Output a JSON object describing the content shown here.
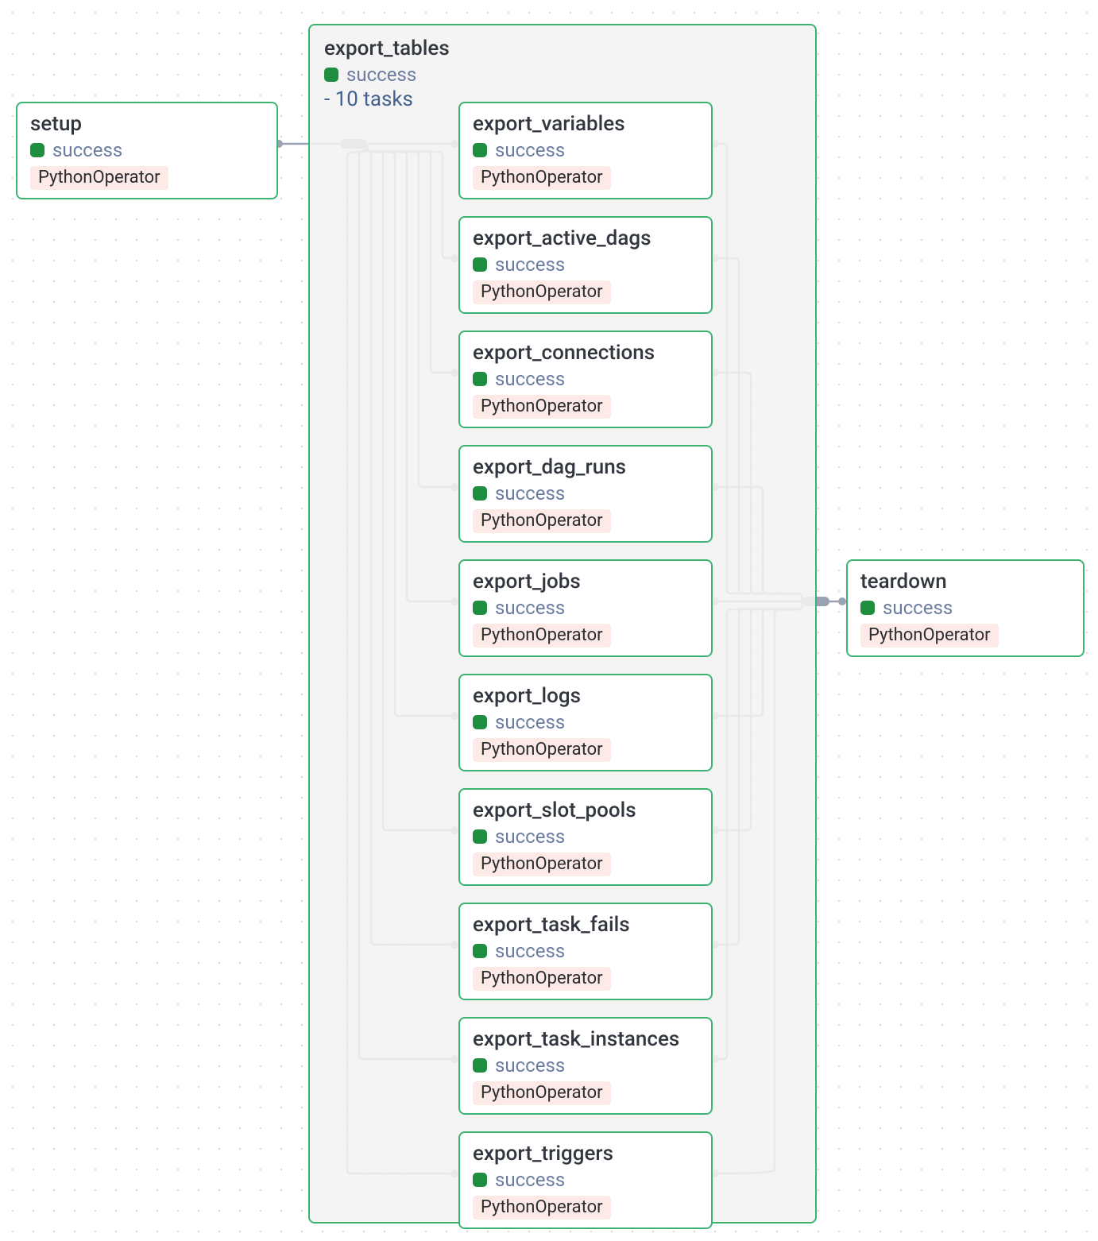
{
  "colors": {
    "success_green": "#3cb371",
    "status_square": "#1f8f3f",
    "badge_bg": "#fde9e6",
    "edge": "#98a2b3",
    "text_dark": "#32363e",
    "text_muted": "#6c7ca0",
    "expand_blue": "#45628f"
  },
  "setup": {
    "title": "setup",
    "status": "success",
    "operator": "PythonOperator"
  },
  "teardown": {
    "title": "teardown",
    "status": "success",
    "operator": "PythonOperator"
  },
  "group": {
    "title": "export_tables",
    "status": "success",
    "task_count_label": "- 10 tasks"
  },
  "tasks": [
    {
      "title": "export_variables",
      "status": "success",
      "operator": "PythonOperator"
    },
    {
      "title": "export_active_dags",
      "status": "success",
      "operator": "PythonOperator"
    },
    {
      "title": "export_connections",
      "status": "success",
      "operator": "PythonOperator"
    },
    {
      "title": "export_dag_runs",
      "status": "success",
      "operator": "PythonOperator"
    },
    {
      "title": "export_jobs",
      "status": "success",
      "operator": "PythonOperator"
    },
    {
      "title": "export_logs",
      "status": "success",
      "operator": "PythonOperator"
    },
    {
      "title": "export_slot_pools",
      "status": "success",
      "operator": "PythonOperator"
    },
    {
      "title": "export_task_fails",
      "status": "success",
      "operator": "PythonOperator"
    },
    {
      "title": "export_task_instances",
      "status": "success",
      "operator": "PythonOperator"
    },
    {
      "title": "export_triggers",
      "status": "success",
      "operator": "PythonOperator"
    }
  ]
}
